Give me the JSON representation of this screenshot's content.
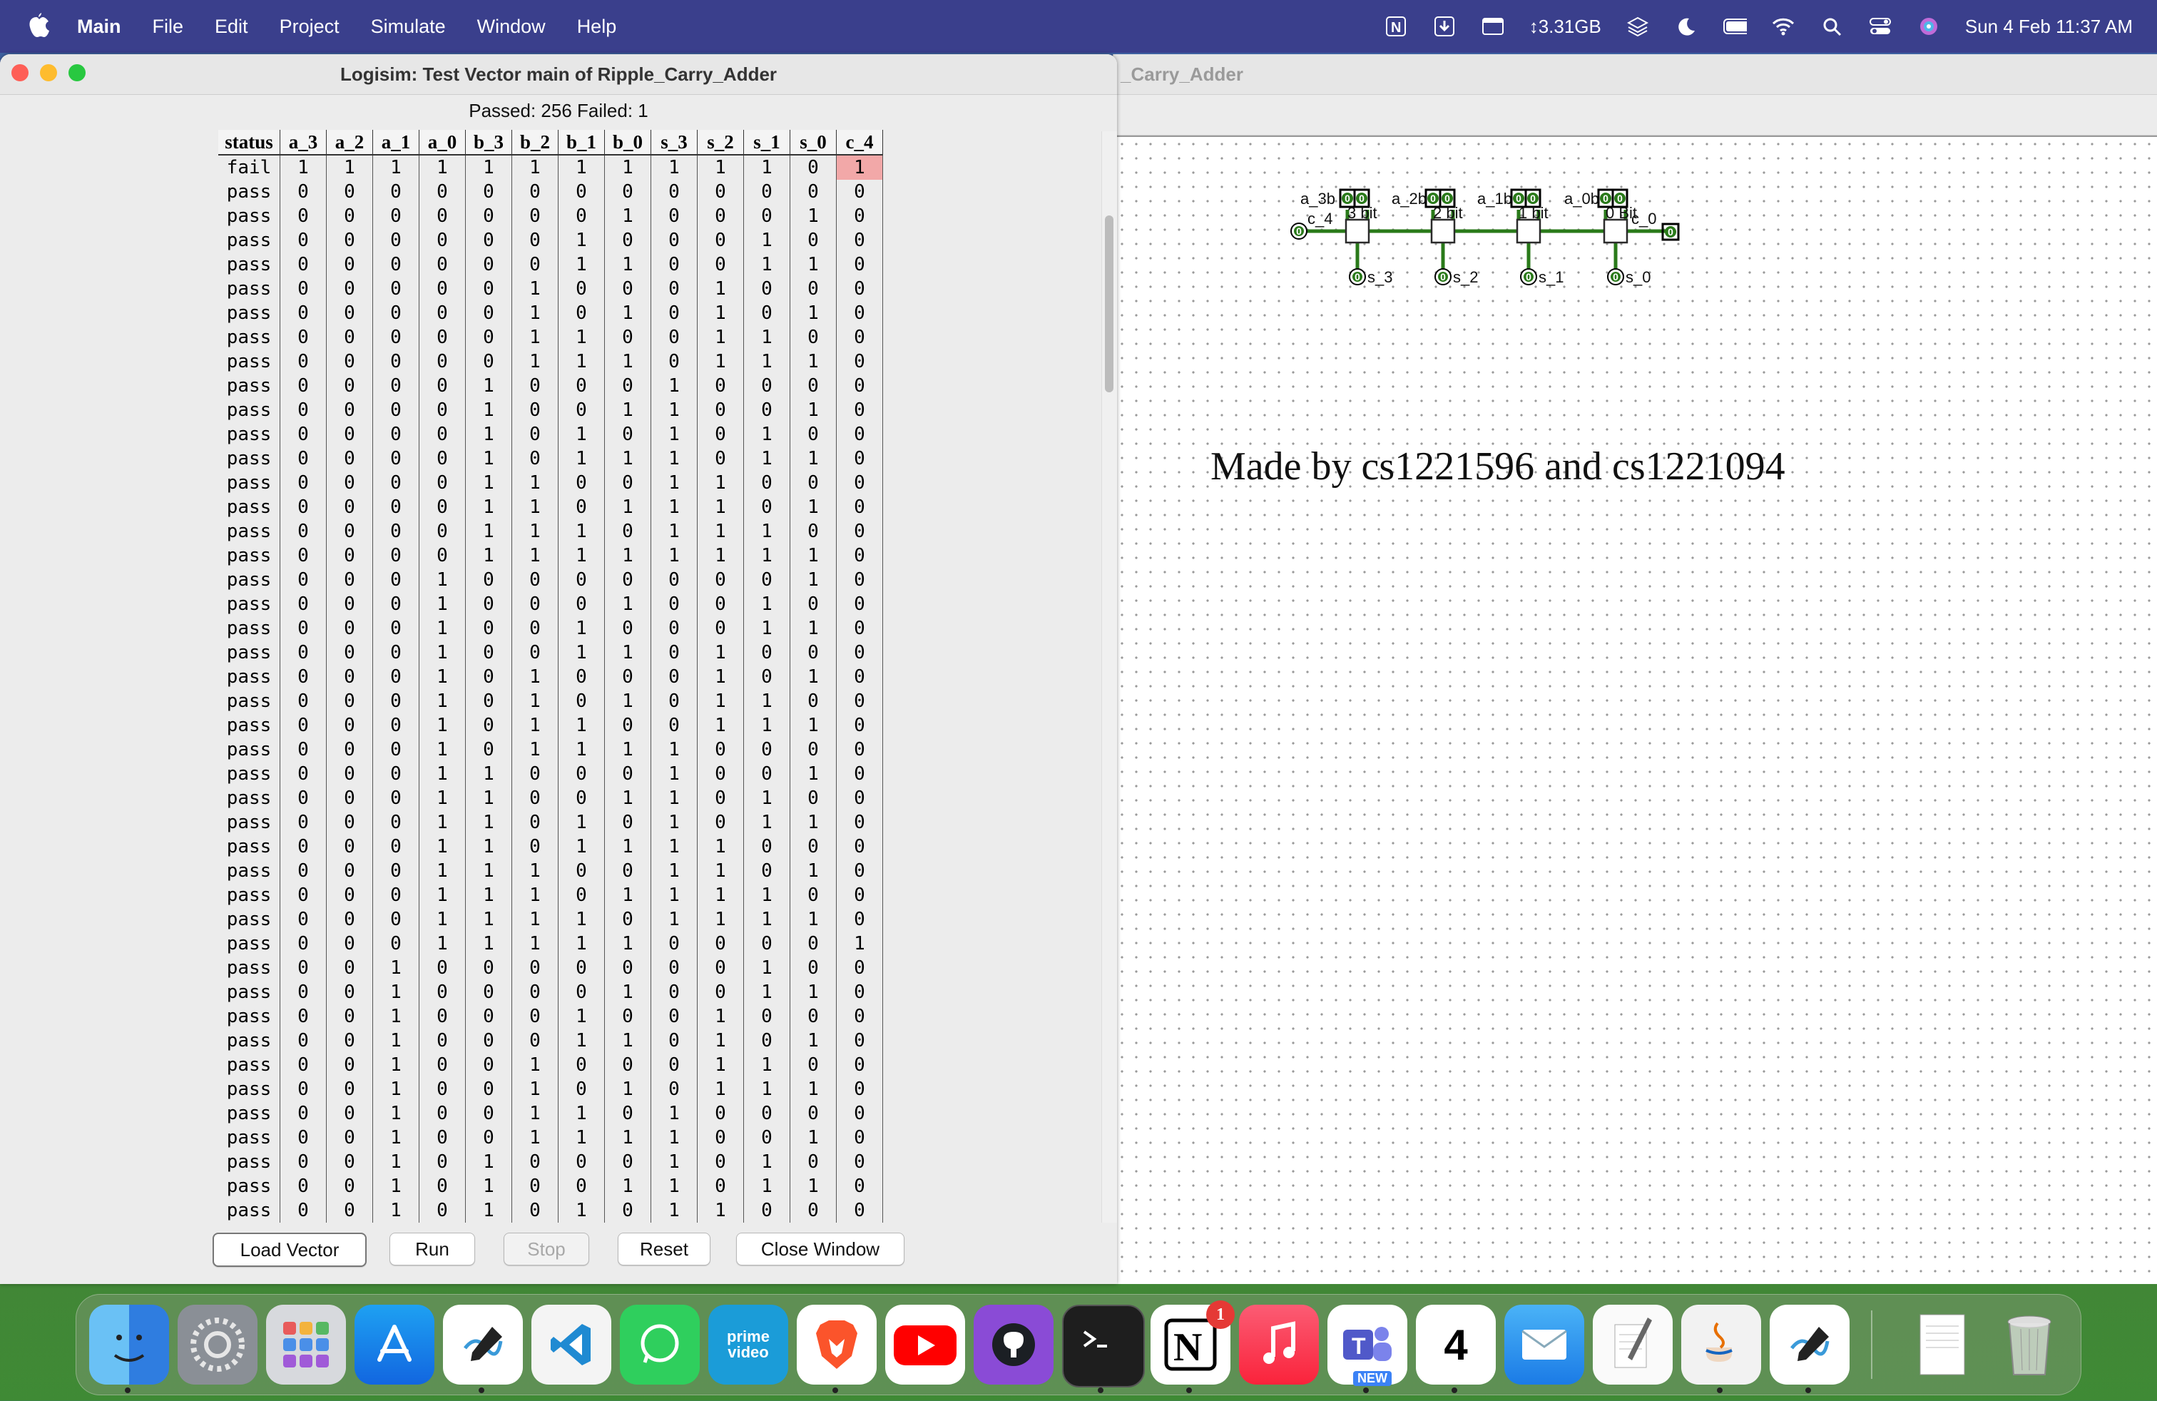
{
  "menubar": {
    "app_name": "Main",
    "items": [
      "File",
      "Edit",
      "Project",
      "Simulate",
      "Window",
      "Help"
    ],
    "memory": "↕3.31GB",
    "datetime": "Sun 4 Feb  11:37 AM"
  },
  "bg_window": {
    "title": "_Carry_Adder",
    "made_by": "Made by cs1221596 and cs1221094",
    "labels": {
      "a3b3": "a_3b",
      "a2b2": "a_2b",
      "a1b1": "a_1b",
      "a0b0": "a_0b",
      "c4": "c_4",
      "c0": "c_0",
      "bit3": "3 bit",
      "bit2": "2 bit",
      "bit1": "1 bit",
      "bit0": "0 Bit",
      "s3": "s_3",
      "s2": "s_2",
      "s1": "s_1",
      "s0": "s_0",
      "zero": "0"
    }
  },
  "test_window": {
    "title": "Logisim: Test Vector main of Ripple_Carry_Adder",
    "summary": "Passed: 256 Failed: 1",
    "columns": [
      "status",
      "a_3",
      "a_2",
      "a_1",
      "a_0",
      "b_3",
      "b_2",
      "b_1",
      "b_0",
      "s_3",
      "s_2",
      "s_1",
      "s_0",
      "c_4"
    ],
    "rows": [
      [
        "fail",
        "1",
        "1",
        "1",
        "1",
        "1",
        "1",
        "1",
        "1",
        "1",
        "1",
        "1",
        "0",
        "1"
      ],
      [
        "pass",
        "0",
        "0",
        "0",
        "0",
        "0",
        "0",
        "0",
        "0",
        "0",
        "0",
        "0",
        "0",
        "0"
      ],
      [
        "pass",
        "0",
        "0",
        "0",
        "0",
        "0",
        "0",
        "0",
        "1",
        "0",
        "0",
        "0",
        "1",
        "0"
      ],
      [
        "pass",
        "0",
        "0",
        "0",
        "0",
        "0",
        "0",
        "1",
        "0",
        "0",
        "0",
        "1",
        "0",
        "0"
      ],
      [
        "pass",
        "0",
        "0",
        "0",
        "0",
        "0",
        "0",
        "1",
        "1",
        "0",
        "0",
        "1",
        "1",
        "0"
      ],
      [
        "pass",
        "0",
        "0",
        "0",
        "0",
        "0",
        "1",
        "0",
        "0",
        "0",
        "1",
        "0",
        "0",
        "0"
      ],
      [
        "pass",
        "0",
        "0",
        "0",
        "0",
        "0",
        "1",
        "0",
        "1",
        "0",
        "1",
        "0",
        "1",
        "0"
      ],
      [
        "pass",
        "0",
        "0",
        "0",
        "0",
        "0",
        "1",
        "1",
        "0",
        "0",
        "1",
        "1",
        "0",
        "0"
      ],
      [
        "pass",
        "0",
        "0",
        "0",
        "0",
        "0",
        "1",
        "1",
        "1",
        "0",
        "1",
        "1",
        "1",
        "0"
      ],
      [
        "pass",
        "0",
        "0",
        "0",
        "0",
        "1",
        "0",
        "0",
        "0",
        "1",
        "0",
        "0",
        "0",
        "0"
      ],
      [
        "pass",
        "0",
        "0",
        "0",
        "0",
        "1",
        "0",
        "0",
        "1",
        "1",
        "0",
        "0",
        "1",
        "0"
      ],
      [
        "pass",
        "0",
        "0",
        "0",
        "0",
        "1",
        "0",
        "1",
        "0",
        "1",
        "0",
        "1",
        "0",
        "0"
      ],
      [
        "pass",
        "0",
        "0",
        "0",
        "0",
        "1",
        "0",
        "1",
        "1",
        "1",
        "0",
        "1",
        "1",
        "0"
      ],
      [
        "pass",
        "0",
        "0",
        "0",
        "0",
        "1",
        "1",
        "0",
        "0",
        "1",
        "1",
        "0",
        "0",
        "0"
      ],
      [
        "pass",
        "0",
        "0",
        "0",
        "0",
        "1",
        "1",
        "0",
        "1",
        "1",
        "1",
        "0",
        "1",
        "0"
      ],
      [
        "pass",
        "0",
        "0",
        "0",
        "0",
        "1",
        "1",
        "1",
        "0",
        "1",
        "1",
        "1",
        "0",
        "0"
      ],
      [
        "pass",
        "0",
        "0",
        "0",
        "0",
        "1",
        "1",
        "1",
        "1",
        "1",
        "1",
        "1",
        "1",
        "0"
      ],
      [
        "pass",
        "0",
        "0",
        "0",
        "1",
        "0",
        "0",
        "0",
        "0",
        "0",
        "0",
        "0",
        "1",
        "0"
      ],
      [
        "pass",
        "0",
        "0",
        "0",
        "1",
        "0",
        "0",
        "0",
        "1",
        "0",
        "0",
        "1",
        "0",
        "0"
      ],
      [
        "pass",
        "0",
        "0",
        "0",
        "1",
        "0",
        "0",
        "1",
        "0",
        "0",
        "0",
        "1",
        "1",
        "0"
      ],
      [
        "pass",
        "0",
        "0",
        "0",
        "1",
        "0",
        "0",
        "1",
        "1",
        "0",
        "1",
        "0",
        "0",
        "0"
      ],
      [
        "pass",
        "0",
        "0",
        "0",
        "1",
        "0",
        "1",
        "0",
        "0",
        "0",
        "1",
        "0",
        "1",
        "0"
      ],
      [
        "pass",
        "0",
        "0",
        "0",
        "1",
        "0",
        "1",
        "0",
        "1",
        "0",
        "1",
        "1",
        "0",
        "0"
      ],
      [
        "pass",
        "0",
        "0",
        "0",
        "1",
        "0",
        "1",
        "1",
        "0",
        "0",
        "1",
        "1",
        "1",
        "0"
      ],
      [
        "pass",
        "0",
        "0",
        "0",
        "1",
        "0",
        "1",
        "1",
        "1",
        "1",
        "0",
        "0",
        "0",
        "0"
      ],
      [
        "pass",
        "0",
        "0",
        "0",
        "1",
        "1",
        "0",
        "0",
        "0",
        "1",
        "0",
        "0",
        "1",
        "0"
      ],
      [
        "pass",
        "0",
        "0",
        "0",
        "1",
        "1",
        "0",
        "0",
        "1",
        "1",
        "0",
        "1",
        "0",
        "0"
      ],
      [
        "pass",
        "0",
        "0",
        "0",
        "1",
        "1",
        "0",
        "1",
        "0",
        "1",
        "0",
        "1",
        "1",
        "0"
      ],
      [
        "pass",
        "0",
        "0",
        "0",
        "1",
        "1",
        "0",
        "1",
        "1",
        "1",
        "1",
        "0",
        "0",
        "0"
      ],
      [
        "pass",
        "0",
        "0",
        "0",
        "1",
        "1",
        "1",
        "0",
        "0",
        "1",
        "1",
        "0",
        "1",
        "0"
      ],
      [
        "pass",
        "0",
        "0",
        "0",
        "1",
        "1",
        "1",
        "0",
        "1",
        "1",
        "1",
        "1",
        "0",
        "0"
      ],
      [
        "pass",
        "0",
        "0",
        "0",
        "1",
        "1",
        "1",
        "1",
        "0",
        "1",
        "1",
        "1",
        "1",
        "0"
      ],
      [
        "pass",
        "0",
        "0",
        "0",
        "1",
        "1",
        "1",
        "1",
        "1",
        "0",
        "0",
        "0",
        "0",
        "1"
      ],
      [
        "pass",
        "0",
        "0",
        "1",
        "0",
        "0",
        "0",
        "0",
        "0",
        "0",
        "0",
        "1",
        "0",
        "0"
      ],
      [
        "pass",
        "0",
        "0",
        "1",
        "0",
        "0",
        "0",
        "0",
        "1",
        "0",
        "0",
        "1",
        "1",
        "0"
      ],
      [
        "pass",
        "0",
        "0",
        "1",
        "0",
        "0",
        "0",
        "1",
        "0",
        "0",
        "1",
        "0",
        "0",
        "0"
      ],
      [
        "pass",
        "0",
        "0",
        "1",
        "0",
        "0",
        "0",
        "1",
        "1",
        "0",
        "1",
        "0",
        "1",
        "0"
      ],
      [
        "pass",
        "0",
        "0",
        "1",
        "0",
        "0",
        "1",
        "0",
        "0",
        "0",
        "1",
        "1",
        "0",
        "0"
      ],
      [
        "pass",
        "0",
        "0",
        "1",
        "0",
        "0",
        "1",
        "0",
        "1",
        "0",
        "1",
        "1",
        "1",
        "0"
      ],
      [
        "pass",
        "0",
        "0",
        "1",
        "0",
        "0",
        "1",
        "1",
        "0",
        "1",
        "0",
        "0",
        "0",
        "0"
      ],
      [
        "pass",
        "0",
        "0",
        "1",
        "0",
        "0",
        "1",
        "1",
        "1",
        "1",
        "0",
        "0",
        "1",
        "0"
      ],
      [
        "pass",
        "0",
        "0",
        "1",
        "0",
        "1",
        "0",
        "0",
        "0",
        "1",
        "0",
        "1",
        "0",
        "0"
      ],
      [
        "pass",
        "0",
        "0",
        "1",
        "0",
        "1",
        "0",
        "0",
        "1",
        "1",
        "0",
        "1",
        "1",
        "0"
      ],
      [
        "pass",
        "0",
        "0",
        "1",
        "0",
        "1",
        "0",
        "1",
        "0",
        "1",
        "1",
        "0",
        "0",
        "0"
      ]
    ],
    "buttons": {
      "load": "Load Vector",
      "run": "Run",
      "stop": "Stop",
      "reset": "Reset",
      "close": "Close Window"
    }
  },
  "dock": {
    "apps": [
      "Finder",
      "System Settings",
      "Launchpad",
      "App Store",
      "Freeform",
      "VS Code",
      "WhatsApp",
      "Prime Video",
      "Brave",
      "YouTube",
      "GitHub Desktop",
      "Terminal",
      "Notion",
      "Music",
      "Teams",
      "Calendar",
      "Mail",
      "TextEdit",
      "Java",
      "Freeform Doc",
      "Documents",
      "Trash"
    ],
    "prime_label": "prime video",
    "notion_badge": "1",
    "teams_new": "NEW",
    "calendar_day": "4"
  },
  "colors": {
    "menubar": "#3a3f8c",
    "fail_highlight": "#f2a8a8",
    "wire_green": "#2a7a1a"
  }
}
